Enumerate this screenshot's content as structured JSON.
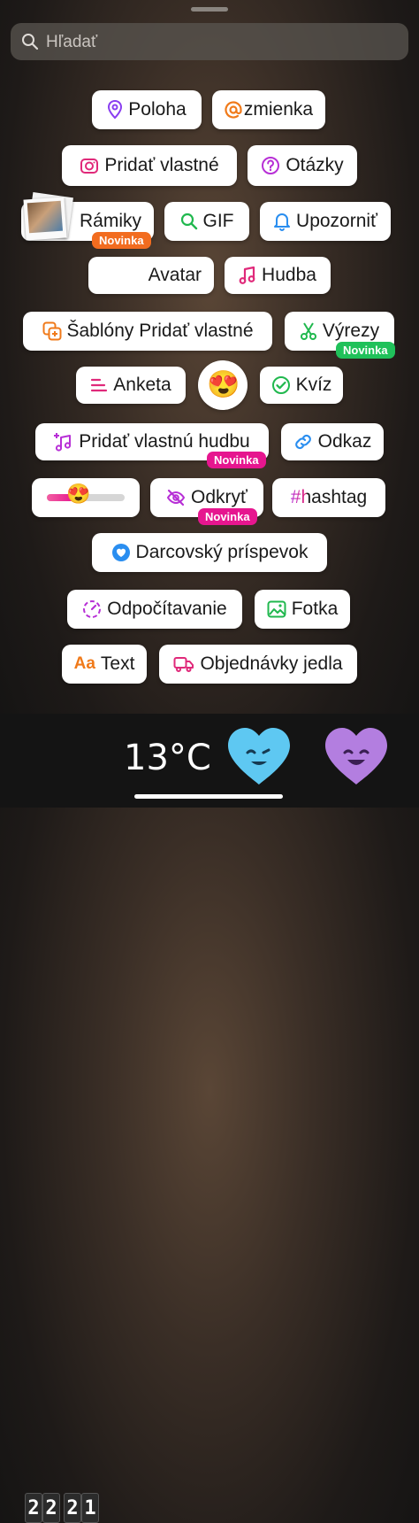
{
  "search": {
    "placeholder": "Hľadať"
  },
  "stickers": {
    "poloha": "Poloha",
    "zmienka": "zmienka",
    "pridat_vlastne": "Pridať vlastné",
    "otazky": "Otázky",
    "ramiky": "Rámiky",
    "gif": "GIF",
    "upozornit": "Upozorniť",
    "avatar": "Avatar",
    "hudba": "Hudba",
    "sablony": "Šablóny Pridať vlastné",
    "vyrezy": "Výrezy",
    "anketa": "Anketa",
    "kviz": "Kvíz",
    "pridat_hudbu": "Pridať vlastnú hudbu",
    "odkaz": "Odkaz",
    "odkryt": "Odkryť",
    "hashtag": "#hashtag",
    "darcovsky": "Darcovský príspevok",
    "odpocitavanie": "Odpočítavanie",
    "fotka": "Fotka",
    "text": "Text",
    "text_icon": "Aa",
    "objednavky": "Objednávky jedla"
  },
  "badges": {
    "ramiky": "Novinka",
    "vyrezy": "Novinka",
    "pridat_hudbu": "Novinka",
    "odkryt": "Novinka"
  },
  "emoji": {
    "heart_eyes": "😍"
  },
  "slider": {
    "emoji": "😍",
    "level": 0.35
  },
  "bottom_bar": {
    "clock_digits": [
      "2",
      "2",
      "2",
      "1"
    ],
    "temperature": "13°C"
  },
  "colors": {
    "badge_orange": "#f26c1f",
    "badge_green": "#20c15a",
    "badge_pink": "#e6168f",
    "heart_blue": "#5ec8f2",
    "heart_purple": "#b37ee0"
  }
}
